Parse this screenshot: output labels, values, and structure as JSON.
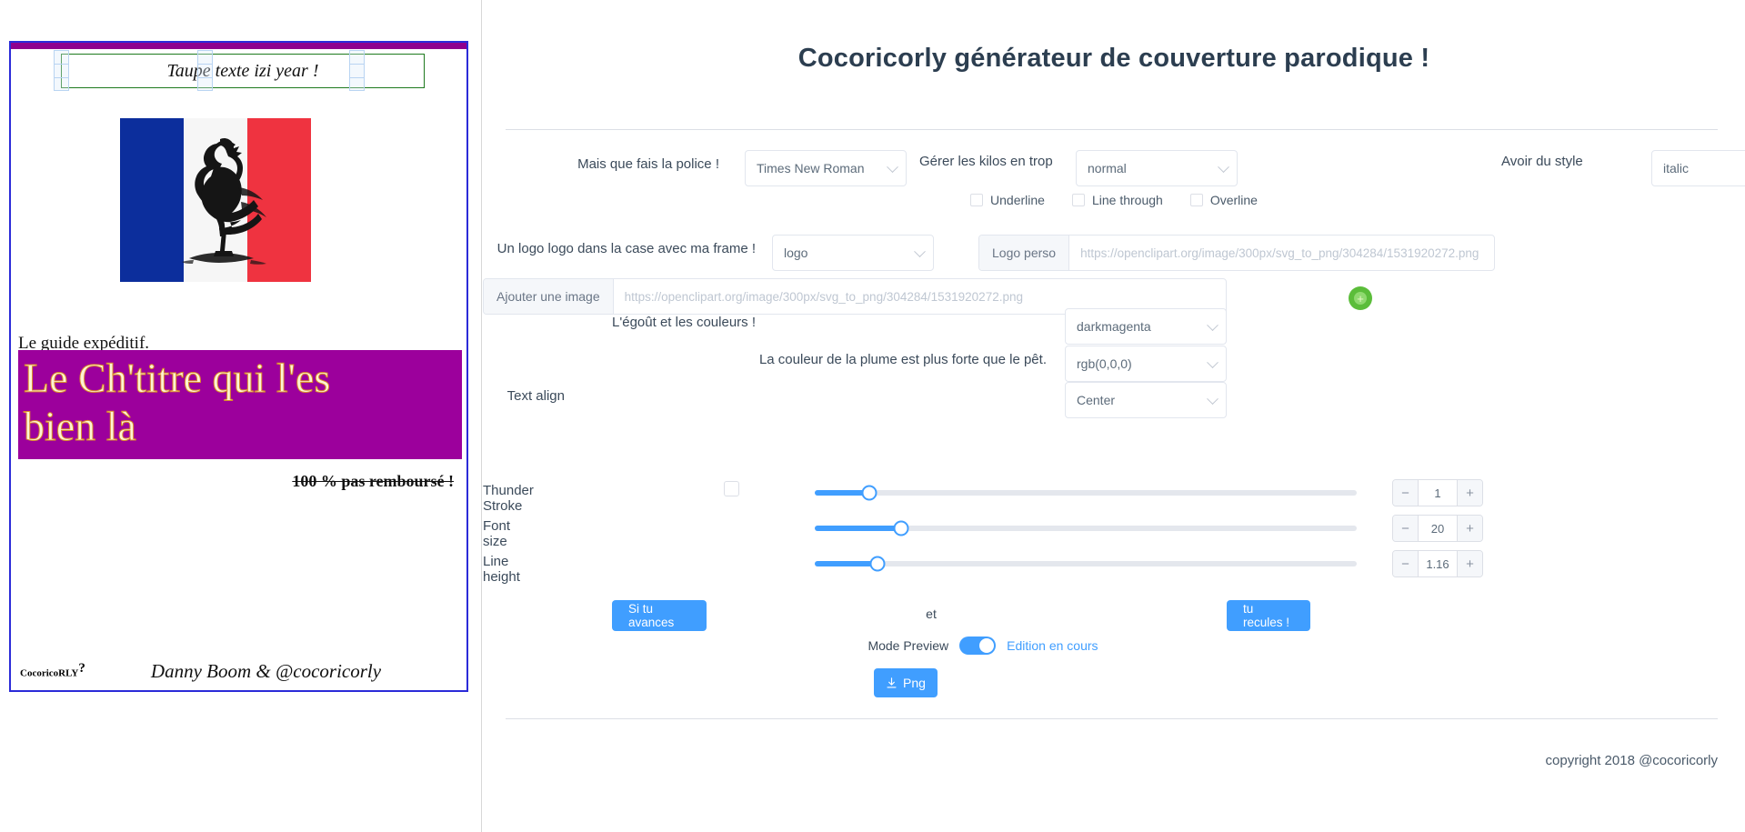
{
  "preview": {
    "editable_title": "Taupe texte izi year !",
    "subtitle": "Le guide expéditif.",
    "title_lines": [
      "Le Ch'titre qui l'es",
      "bien là"
    ],
    "price_note": "100 % pas remboursé !",
    "brand": "CocoricoRLY",
    "brand_sup": "?",
    "author": "Danny Boom & @cocoricorly",
    "colors": {
      "card_border": "#2b2bd8",
      "top_bar": "#8e008e",
      "title_band": "#9c009c",
      "title_fill": "#fdf3d4",
      "title_stroke": "#d98a2b",
      "selection_box": "#1e7a1e",
      "handle": "#b9d4f2",
      "flag_blue": "#0c2e9c",
      "flag_white": "#f6f6f6",
      "flag_red": "#ef3340"
    }
  },
  "header": {
    "title": "Cocoricorly générateur de couverture parodique !"
  },
  "font_row": {
    "font_label": "Mais que fais la police !",
    "font_value": "Times New Roman",
    "weight_label": "Gérer les kilos en trop",
    "weight_value": "normal",
    "style_label": "Avoir du style",
    "style_value": "italic"
  },
  "decorations": [
    {
      "label": "Underline",
      "checked": false
    },
    {
      "label": "Line through",
      "checked": false
    },
    {
      "label": "Overline",
      "checked": false
    }
  ],
  "logo_row": {
    "label": "Un logo logo dans la case avec ma frame !",
    "select_value": "logo",
    "perso_addon": "Logo perso",
    "perso_placeholder": "https://openclipart.org/image/300px/svg_to_png/304284/1531920272.png",
    "image_addon": "Ajouter une image",
    "image_placeholder": "https://openclipart.org/image/300px/svg_to_png/304284/1531920272.png",
    "add_icon": "plus-circle-icon"
  },
  "color_rows": {
    "bg_label": "L'égoût et les couleurs !",
    "bg_value": "darkmagenta",
    "pen_label": "La couleur de la plume est plus forte que le pêt.",
    "pen_value": "rgb(0,0,0)",
    "align_label": "Text align",
    "align_value": "Center"
  },
  "sliders": [
    {
      "label": "Thunder Stroke",
      "value": "1",
      "percent": 10,
      "has_checkbox": true,
      "checked": false
    },
    {
      "label": "Font size",
      "value": "20",
      "percent": 16,
      "has_checkbox": false,
      "checked": false
    },
    {
      "label": "Line height",
      "value": "1.16",
      "percent": 11.6,
      "has_checkbox": false,
      "checked": false
    }
  ],
  "nav": {
    "prev_label": "Si tu avances",
    "separator": "et",
    "next_label": "tu recules !"
  },
  "preview_mode": {
    "label": "Mode Preview",
    "enabled": true,
    "state_label": "Edition en cours"
  },
  "download": {
    "label": "Png",
    "icon": "download-icon"
  },
  "footer": {
    "copyright": "copyright 2018 @cocoricorly"
  },
  "theme": {
    "primary": "#409eff",
    "title_color": "#2c3e50",
    "add_green": "#5bbd3a"
  }
}
